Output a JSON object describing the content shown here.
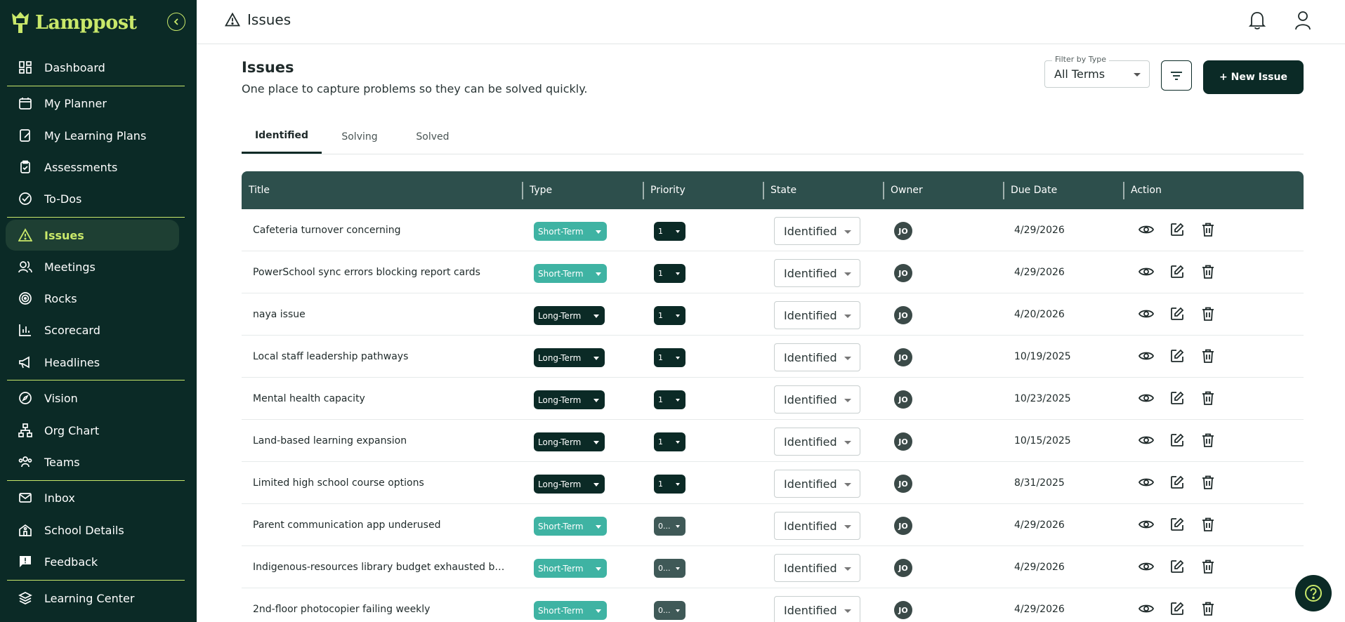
{
  "app": {
    "name": "Lamppost"
  },
  "sidebar": {
    "items": [
      {
        "label": "Dashboard",
        "icon": "dashboard-icon"
      },
      {
        "label": "My Planner",
        "icon": "calendar-icon"
      },
      {
        "label": "My Learning Plans",
        "icon": "notebook-icon"
      },
      {
        "label": "Assessments",
        "icon": "clipboard-icon"
      },
      {
        "label": "To-Dos",
        "icon": "check-circle-icon"
      },
      {
        "label": "Issues",
        "icon": "warning-icon",
        "active": true
      },
      {
        "label": "Meetings",
        "icon": "people-icon"
      },
      {
        "label": "Rocks",
        "icon": "target-icon"
      },
      {
        "label": "Scorecard",
        "icon": "bar-chart-icon"
      },
      {
        "label": "Headlines",
        "icon": "megaphone-icon"
      },
      {
        "label": "Vision",
        "icon": "compass-icon"
      },
      {
        "label": "Org Chart",
        "icon": "org-chart-icon"
      },
      {
        "label": "Teams",
        "icon": "team-icon"
      },
      {
        "label": "Inbox",
        "icon": "mail-icon"
      },
      {
        "label": "School Details",
        "icon": "school-icon"
      },
      {
        "label": "Feedback",
        "icon": "feedback-icon"
      },
      {
        "label": "Learning Center",
        "icon": "layers-icon"
      }
    ]
  },
  "topbar": {
    "title": "Issues"
  },
  "header": {
    "title": "Issues",
    "subtitle": "One place to capture problems so they can be solved quickly.",
    "filter_label": "Filter by Type",
    "filter_value": "All Terms",
    "new_button": "+ New Issue"
  },
  "tabs": [
    {
      "label": "Identified",
      "active": true
    },
    {
      "label": "Solving"
    },
    {
      "label": "Solved"
    }
  ],
  "table": {
    "columns": [
      "Title",
      "Type",
      "Priority",
      "State",
      "Owner",
      "Due Date",
      "Action"
    ],
    "rows": [
      {
        "title": "Cafeteria turnover concerning",
        "type": "Short-Term",
        "priority": "1",
        "state": "Identified",
        "owner": "JO",
        "due": "4/29/2026"
      },
      {
        "title": "PowerSchool sync errors blocking report cards",
        "type": "Short-Term",
        "priority": "1",
        "state": "Identified",
        "owner": "JO",
        "due": "4/29/2026"
      },
      {
        "title": "naya issue",
        "type": "Long-Term",
        "priority": "1",
        "state": "Identified",
        "owner": "JO",
        "due": "4/20/2026"
      },
      {
        "title": "Local staff leadership pathways",
        "type": "Long-Term",
        "priority": "1",
        "state": "Identified",
        "owner": "JO",
        "due": "10/19/2025"
      },
      {
        "title": "Mental health capacity",
        "type": "Long-Term",
        "priority": "1",
        "state": "Identified",
        "owner": "JO",
        "due": "10/23/2025"
      },
      {
        "title": "Land-based learning expansion",
        "type": "Long-Term",
        "priority": "1",
        "state": "Identified",
        "owner": "JO",
        "due": "10/15/2025"
      },
      {
        "title": "Limited high school course options",
        "type": "Long-Term",
        "priority": "1",
        "state": "Identified",
        "owner": "JO",
        "due": "8/31/2025"
      },
      {
        "title": "Parent communication app underused",
        "type": "Short-Term",
        "priority": "0...",
        "state": "Identified",
        "owner": "JO",
        "due": "4/29/2026"
      },
      {
        "title": "Indigenous-resources library budget exhausted by ...",
        "type": "Short-Term",
        "priority": "0...",
        "state": "Identified",
        "owner": "JO",
        "due": "4/29/2026"
      },
      {
        "title": "2nd-floor photocopier failing weekly",
        "type": "Short-Term",
        "priority": "0...",
        "state": "Identified",
        "owner": "JO",
        "due": "4/29/2026"
      }
    ]
  },
  "colors": {
    "sidebar_bg": "#0b2a26",
    "accent": "#c9e86a",
    "table_header": "#2d4f4c",
    "short_term": "#3fb3a3",
    "long_term": "#0b2a26"
  }
}
